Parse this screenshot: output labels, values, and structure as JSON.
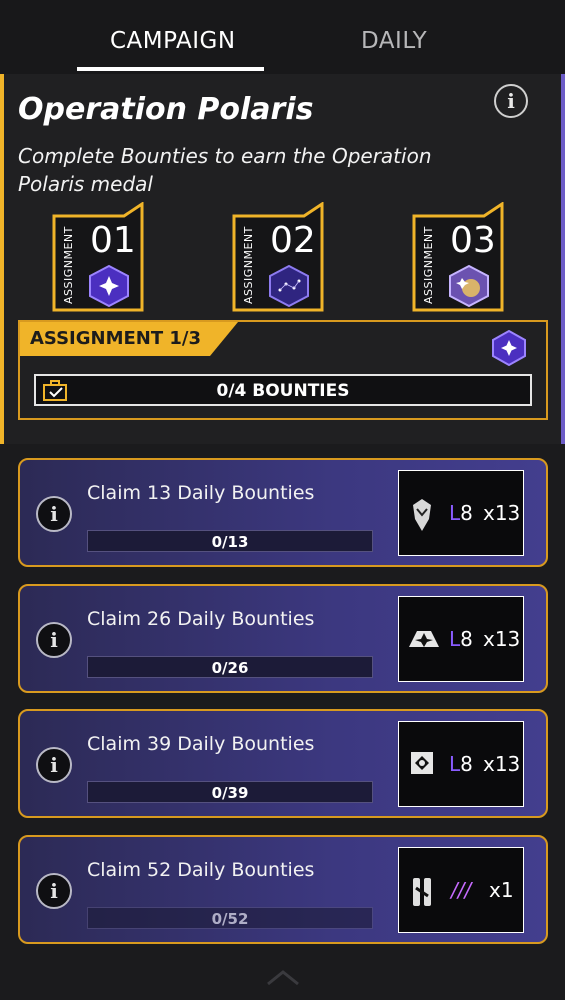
{
  "tabs": [
    {
      "label": "CAMPAIGN",
      "active": true
    },
    {
      "label": "DAILY",
      "active": false
    }
  ],
  "operation": {
    "title": "Operation Polaris",
    "subtitle": "Complete Bounties to earn the Operation Polaris medal",
    "info_icon": "info-icon"
  },
  "assignments": [
    {
      "vertical_label": "ASSIGNMENT",
      "number": "01",
      "hex_color": "#5a3fd0"
    },
    {
      "vertical_label": "ASSIGNMENT",
      "number": "02",
      "hex_color": "#3b2f9a"
    },
    {
      "vertical_label": "ASSIGNMENT",
      "number": "03",
      "hex_color": "#8a6ec9"
    }
  ],
  "current_assignment": {
    "label": "ASSIGNMENT 1/3",
    "progress_text": "0/4 BOUNTIES"
  },
  "bounties": [
    {
      "label": "Claim 13 Daily Bounties",
      "progress": "0/13",
      "reward_icon": "helmet-icon",
      "level": "8",
      "level_prefix": "L",
      "qty": "x13"
    },
    {
      "label": "Claim 26 Daily Bounties",
      "progress": "0/26",
      "reward_icon": "emblem-icon",
      "level": "8",
      "level_prefix": "L",
      "qty": "x13"
    },
    {
      "label": "Claim 39 Daily Bounties",
      "progress": "0/39",
      "reward_icon": "diamond-icon",
      "level": "8",
      "level_prefix": "L",
      "qty": "x13"
    },
    {
      "label": "Claim 52 Daily Bounties",
      "progress": "0/52",
      "reward_icon": "charm-icon",
      "level": "",
      "level_prefix": "///",
      "qty": "x1"
    }
  ],
  "colors": {
    "accent": "#f0b429",
    "purple": "#6c5cc7"
  }
}
